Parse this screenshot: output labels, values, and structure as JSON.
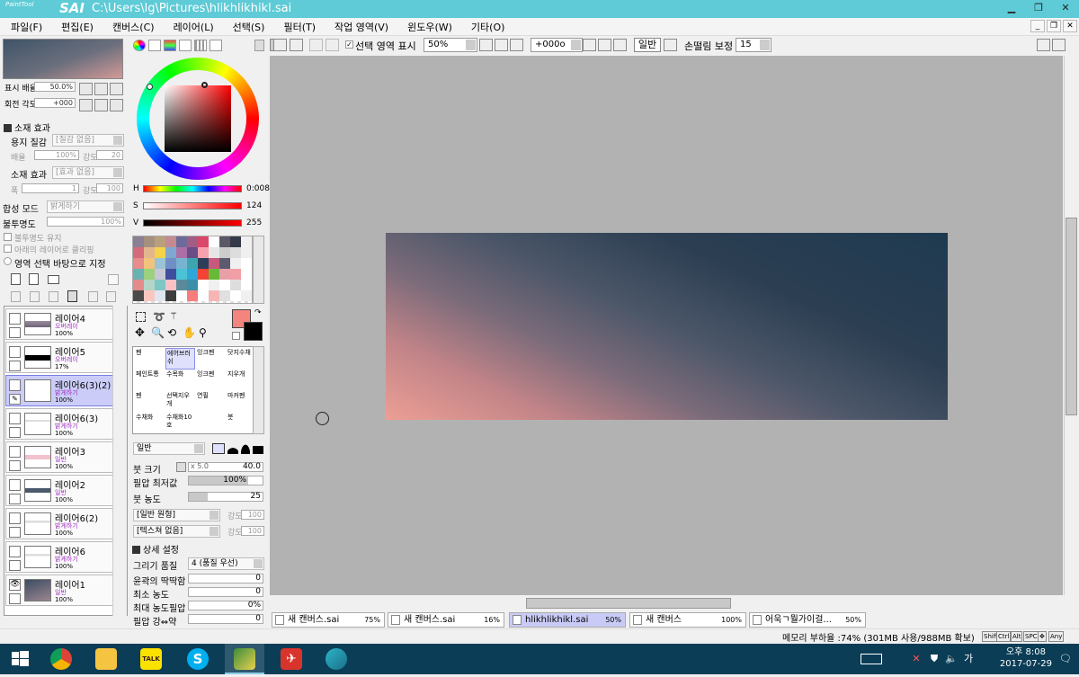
{
  "app": {
    "logo_small": "PaintTool",
    "logo_big": "SAI",
    "title": "C:\\Users\\lg\\Pictures\\hlikhlikhikl.sai"
  },
  "menu": [
    "파일(F)",
    "편집(E)",
    "캔버스(C)",
    "레이어(L)",
    "선택(S)",
    "필터(T)",
    "작업 영역(V)",
    "윈도우(W)",
    "기타(O)"
  ],
  "navigator": {
    "zoom_label": "표시 배율",
    "zoom_value": "50.0%",
    "rotate_label": "회전 각도",
    "rotate_value": "+000"
  },
  "material": {
    "section": "소재 효과",
    "paper_label": "용지 질감",
    "paper_value": "[질감 없음]",
    "scale_label": "배율",
    "scale_value": "100%",
    "strength_label": "강도",
    "strength_value": "20",
    "effect_label": "소재 효과",
    "effect_value": "[효과 없음]",
    "width_label": "폭",
    "width_value": "1",
    "strength2_label": "강도",
    "strength2_value": "100"
  },
  "blend": {
    "mode_label": "합성 모드",
    "mode_value": "밝게하기",
    "opacity_label": "불투명도",
    "opacity_value": "100%",
    "keep_opacity": "불투명도 유지",
    "clip_label": "아래의 레이어로 클리핑",
    "selection_source": "영역 선택 바탕으로 지정"
  },
  "layers": [
    {
      "name": "레이어4",
      "mode": "오버레이",
      "opacity": "100%",
      "thumb": "#9a8d9d",
      "visible": false,
      "selected": false
    },
    {
      "name": "레이어5",
      "mode": "오버레이",
      "opacity": "17%",
      "thumb": "#000000",
      "visible": false,
      "selected": false
    },
    {
      "name": "레이어6(3)(2)",
      "mode": "밝게하기",
      "opacity": "100%",
      "thumb": "#ffffff",
      "visible": false,
      "selected": true
    },
    {
      "name": "레이어6(3)",
      "mode": "밝게하기",
      "opacity": "100%",
      "thumb": "#ffffff",
      "visible": false,
      "selected": false
    },
    {
      "name": "레이어3",
      "mode": "일반",
      "opacity": "100%",
      "thumb": "#f2c2cc",
      "visible": false,
      "selected": false
    },
    {
      "name": "레이어2",
      "mode": "일반",
      "opacity": "100%",
      "thumb": "#4a5a6b",
      "visible": false,
      "selected": false
    },
    {
      "name": "레이어6(2)",
      "mode": "밝게하기",
      "opacity": "100%",
      "thumb": "#ffffff",
      "visible": false,
      "selected": false
    },
    {
      "name": "레이어6",
      "mode": "밝게하기",
      "opacity": "100%",
      "thumb": "#ffffff",
      "visible": false,
      "selected": false
    },
    {
      "name": "레이어1",
      "mode": "일반",
      "opacity": "100%",
      "thumb": "#3c4d62",
      "visible": true,
      "selected": false
    }
  ],
  "color": {
    "h_label": "H",
    "h_value": "0:008",
    "s_label": "S",
    "s_value": "124",
    "v_label": "V",
    "v_value": "255",
    "primary": "#f4847e",
    "secondary": "#000000"
  },
  "swatches": [
    "#8a7f94",
    "#a4907f",
    "#b8a07c",
    "#c48a92",
    "#6e6a99",
    "#a35c84",
    "#d9486a",
    "#ffffff",
    "#5a5866",
    "#343a49",
    "#f0f0f0",
    "#d46a7a",
    "#e3b68d",
    "#f4d34a",
    "#7fa8d0",
    "#ac6fa5",
    "#6a4c86",
    "#f7a0b0",
    "#e6e6e6",
    "#cccccc",
    "#dddddd",
    "#f0f0f0",
    "#e78b8b",
    "#f2c37c",
    "#9ac4d6",
    "#6f8fc6",
    "#78b4d0",
    "#3ea5b0",
    "#2d3e5a",
    "#c75a7c",
    "#5b5a6e",
    "#f0f0f0",
    "#ffffff",
    "#6ab1b2",
    "#9ccf7e",
    "#c7c7d6",
    "#3e4e9c",
    "#4bc2d6",
    "#2ea6d8",
    "#f44336",
    "#66bb36",
    "#e8a0a8",
    "#f19fa6",
    "#ffffff",
    "#e58a8a",
    "#b5d5c8",
    "#7fc6c6",
    "#f7c1c6",
    "#5c8a9a",
    "#3c8fa6",
    "#ffffff",
    "#f0f0f0",
    "#ffffff",
    "#dddddd",
    "#ffffff",
    "#4a4a4a",
    "#f9c7c0",
    "#dfe6ef",
    "#3d3d3d",
    "#ffffff",
    "#f87c7c",
    "#ffffff",
    "#f7b6b6",
    "#e0e0e0",
    "#ffffff",
    "#f0f0f0"
  ],
  "tools": [
    {
      "name": "펜"
    },
    {
      "name": "에어브러쉬"
    },
    {
      "name": "잉크펜"
    },
    {
      "name": "닷지수채"
    },
    {
      "name": "페인트통"
    },
    {
      "name": "수목화"
    },
    {
      "name": "잉크펜"
    },
    {
      "name": "지우개"
    },
    {
      "name": "펜"
    },
    {
      "name": "선택지우개"
    },
    {
      "name": "연필"
    },
    {
      "name": "마커펜"
    },
    {
      "name": "수채화"
    },
    {
      "name": "수채화10호"
    },
    {
      "name": ""
    },
    {
      "name": "붓"
    }
  ],
  "brush": {
    "shape_label": "일반",
    "size_label": "붓 크기",
    "size_mult": "x 5.0",
    "size_value": "40.0",
    "minsize_label": "필압 최저값",
    "minsize_value": "100%",
    "density_label": "붓 농도",
    "density_value": "25",
    "shape_dd": "[일반 원형]",
    "shape_strength": "강도",
    "shape_strength_val": "100",
    "texture_dd": "[텍스쳐 없음]",
    "texture_strength": "강도",
    "texture_strength_val": "100",
    "detail_section": "상세 설정",
    "quality_label": "그리기 품질",
    "quality_value": "4 (품질 우선)",
    "edge_label": "윤곽의 딱딱함",
    "edge_value": "0",
    "mindens_label": "최소 농도",
    "mindens_value": "0",
    "maxpress_label": "최대 농도필압",
    "maxpress_value": "0%",
    "presscurve_label": "필압 강⇔약",
    "presscurve_value": "0"
  },
  "toolbar": {
    "sel_label": "선택 영역 표시",
    "zoom": "50%",
    "rotate": "+000ο",
    "mode": "일반",
    "stab_label": "손떨림 보정",
    "stab_value": "15"
  },
  "doctabs": [
    {
      "name": "새 캔버스.sai",
      "pct": "75%",
      "selected": false
    },
    {
      "name": "새 캔버스.sai",
      "pct": "16%",
      "selected": false
    },
    {
      "name": "hlikhlikhikl.sai",
      "pct": "50%",
      "selected": true
    },
    {
      "name": "새 캔버스",
      "pct": "100%",
      "selected": false
    },
    {
      "name": "어욱ㄱ뭘가이걸...",
      "pct": "50%",
      "selected": false
    }
  ],
  "status": {
    "memory": "메모리 부하율 :74% (301MB 사용/988MB 확보)",
    "keys": [
      "Shift",
      "Ctrl",
      "Alt",
      "SPC",
      "✥",
      "Any"
    ]
  },
  "taskbar": {
    "time_label": "오후 8:08",
    "date_label": "2017-07-29"
  }
}
